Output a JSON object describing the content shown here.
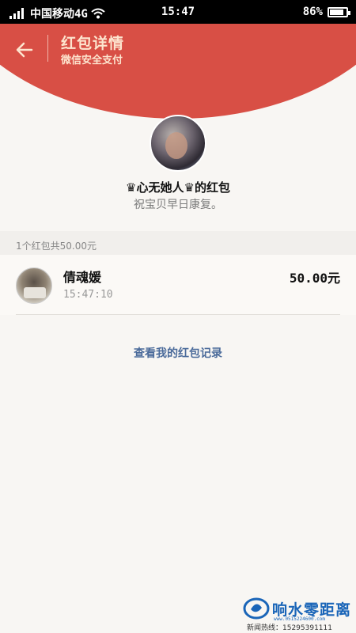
{
  "status_bar": {
    "carrier": "中国移动4G",
    "time": "15:47",
    "battery_percent": "86%",
    "battery_level": 0.86
  },
  "header": {
    "back_icon": "arrow-left-icon",
    "title": "红包详情",
    "subtitle": "微信安全支付"
  },
  "sender": {
    "name": "♛心无她人♛的红包",
    "greeting": "祝宝贝早日康复。"
  },
  "summary": "1个红包共50.00元",
  "records": [
    {
      "name": "倩魂媛",
      "time": "15:47:10",
      "amount": "50.00元"
    }
  ],
  "history_link": "查看我的红包记录",
  "watermark": {
    "title": "响水零距离",
    "url": "www.0515224600.com",
    "hotline": "新闻热线：15295391111"
  },
  "colors": {
    "header_red": "#d84f45",
    "header_text": "#fde5cf",
    "link_blue": "#4a6a9a"
  }
}
